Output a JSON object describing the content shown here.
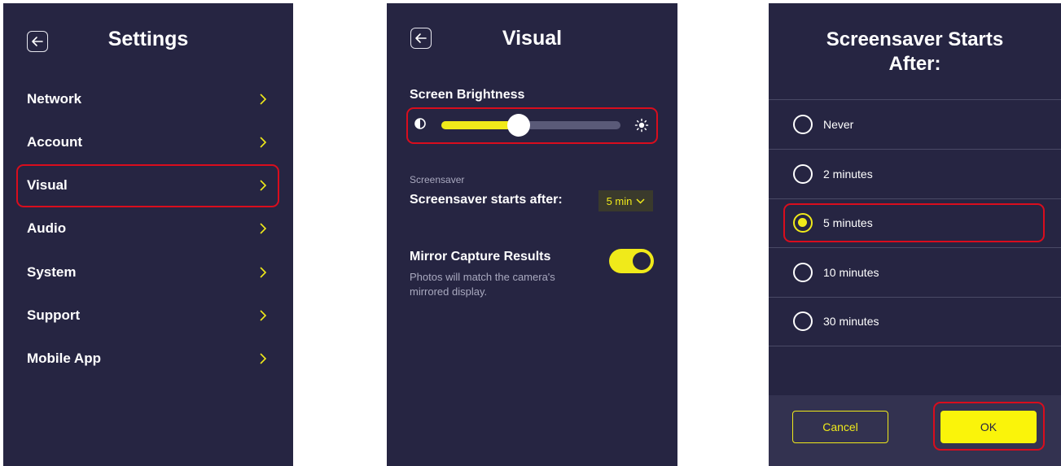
{
  "colors": {
    "panel_bg": "#262542",
    "accent_yellow": "#f0ea1a",
    "highlight_red": "#d90d1d"
  },
  "settings_panel": {
    "title": "Settings",
    "back_icon": "arrow-left-icon",
    "items": [
      {
        "label": "Network"
      },
      {
        "label": "Account"
      },
      {
        "label": "Visual"
      },
      {
        "label": "Audio"
      },
      {
        "label": "System"
      },
      {
        "label": "Support"
      },
      {
        "label": "Mobile App"
      }
    ],
    "highlighted_item": "Visual"
  },
  "visual_panel": {
    "title": "Visual",
    "back_icon": "arrow-left-icon",
    "brightness": {
      "label": "Screen Brightness",
      "level": 0.43,
      "low_icon": "contrast-icon",
      "high_icon": "sun-icon"
    },
    "screensaver": {
      "caption": "Screensaver",
      "label": "Screensaver starts after:",
      "selected_value": "5 min"
    },
    "mirror": {
      "label": "Mirror Capture Results",
      "description": "Photos will match the camera's mirrored display.",
      "enabled": true
    }
  },
  "screensaver_dialog": {
    "title_line1": "Screensaver Starts",
    "title_line2": "After:",
    "options": [
      {
        "label": "Never",
        "checked": false
      },
      {
        "label": "2 minutes",
        "checked": false
      },
      {
        "label": "5 minutes",
        "checked": true
      },
      {
        "label": "10 minutes",
        "checked": false
      },
      {
        "label": "30 minutes",
        "checked": false
      }
    ],
    "cancel_label": "Cancel",
    "ok_label": "OK"
  }
}
